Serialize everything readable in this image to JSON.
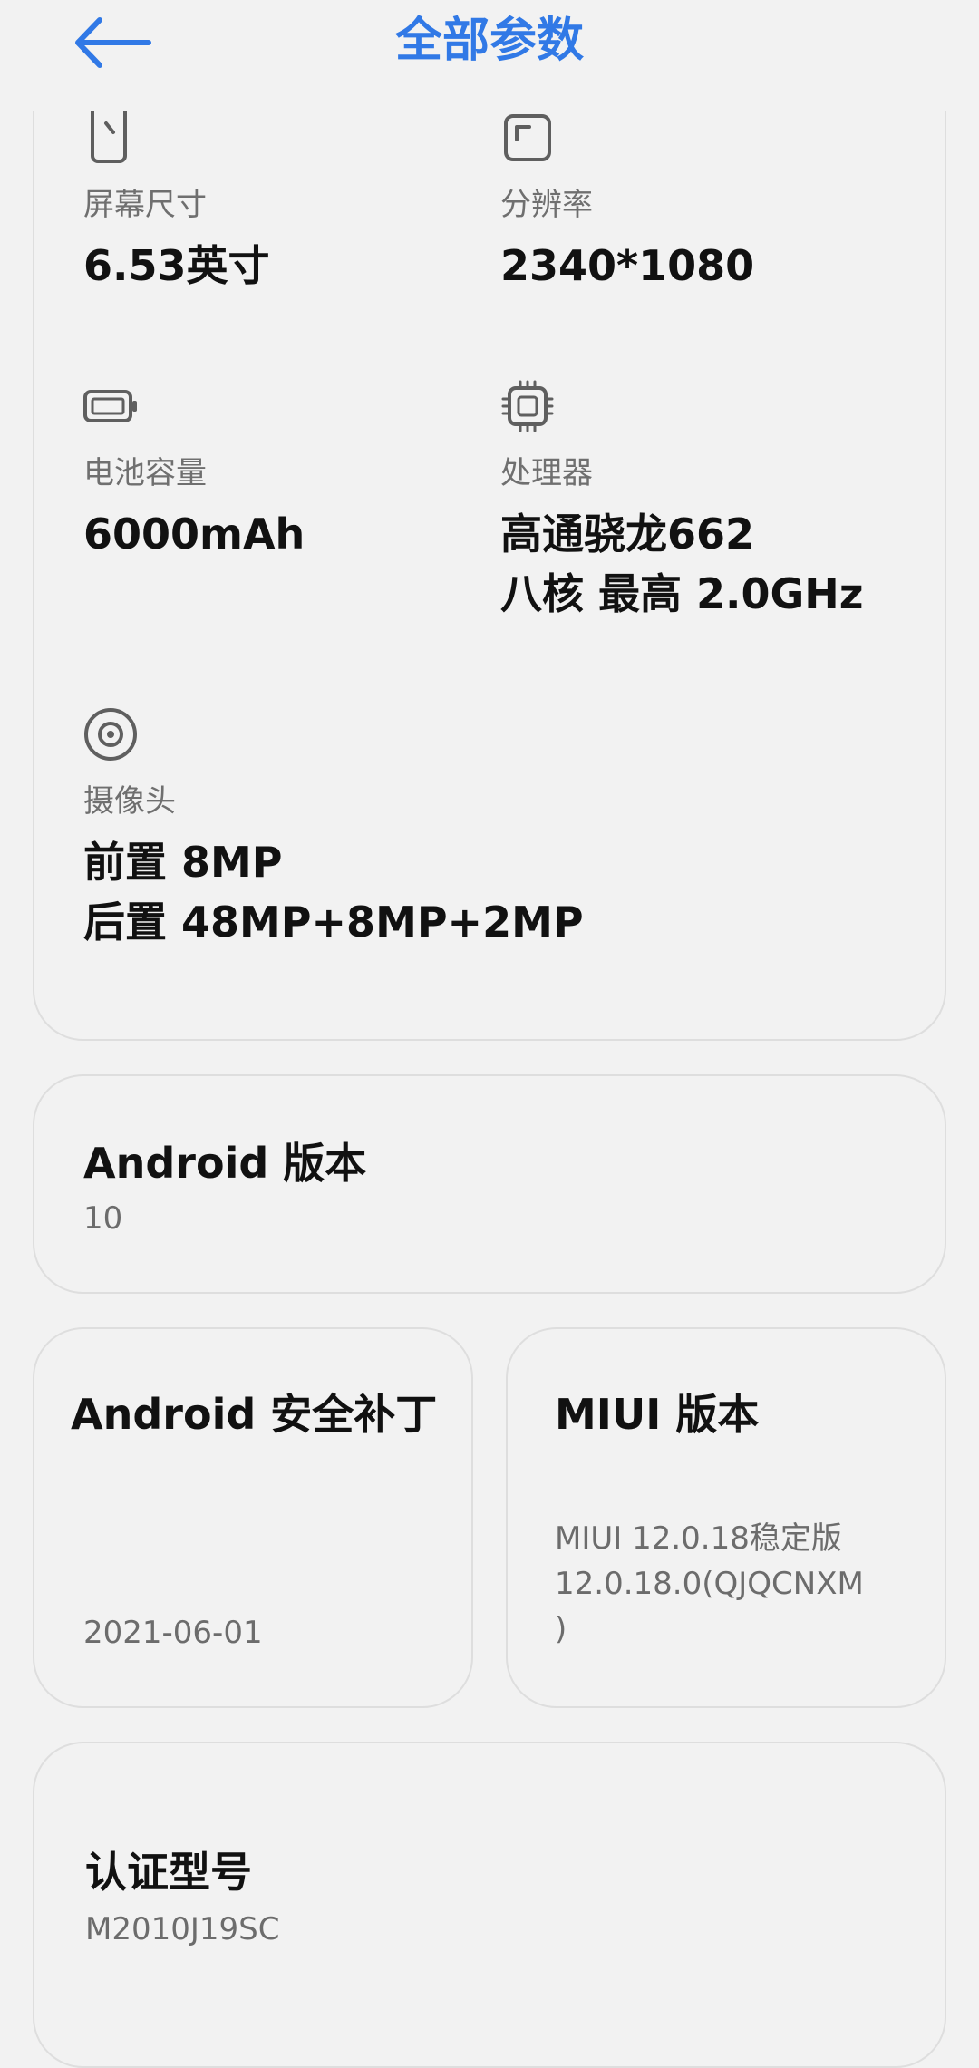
{
  "header": {
    "title": "全部参数",
    "back_icon": "arrow-left-icon",
    "accent_color": "#3179e6"
  },
  "specs": {
    "screen_size": {
      "icon": "phone-screen-icon",
      "label": "屏幕尺寸",
      "value": "6.53英寸"
    },
    "resolution": {
      "icon": "resolution-frame-icon",
      "label": "分辨率",
      "value": "2340*1080"
    },
    "battery": {
      "icon": "battery-icon",
      "label": "电池容量",
      "value": "6000mAh"
    },
    "processor": {
      "icon": "chip-icon",
      "label": "处理器",
      "value_line1": "高通骁龙662",
      "value_line2": "八核 最高 2.0GHz"
    },
    "camera": {
      "icon": "camera-lens-icon",
      "label": "摄像头",
      "value_line1": "前置 8MP",
      "value_line2": "后置 48MP+8MP+2MP"
    }
  },
  "android_version": {
    "title": "Android 版本",
    "value": "10"
  },
  "security_patch": {
    "title": "Android 安全补丁",
    "value": "2021-06-01"
  },
  "miui_version": {
    "title": "MIUI 版本",
    "value_line1": "MIUI 12.0.18稳定版",
    "value_line2": "12.0.18.0(QJQCNXM",
    "value_line3": ")"
  },
  "certified_model": {
    "title": "认证型号",
    "value": "M2010J19SC"
  }
}
